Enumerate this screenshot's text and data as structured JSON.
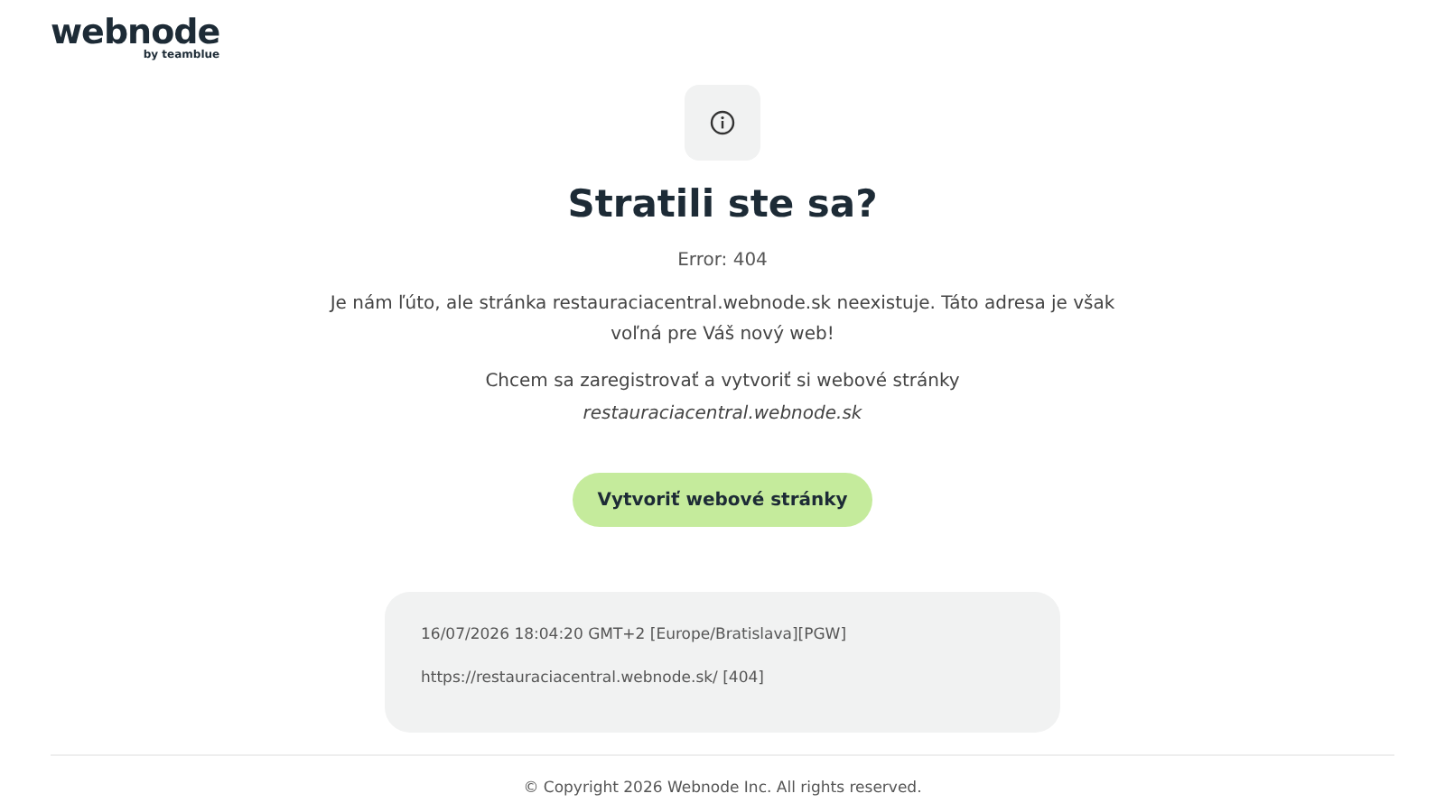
{
  "logo": {
    "name": "webnode",
    "tagline": "by teamblue"
  },
  "heading": "Stratili ste sa?",
  "error": "Error: 404",
  "message": "Je nám ľúto, ale stránka restauraciacentral.webnode.sk neexistuje. Táto adresa je však voľná pre Váš nový web!",
  "register_text": "Chcem sa zaregistrovať a vytvoriť si webové stránky",
  "register_domain": "restauraciacentral.webnode.sk",
  "button": "Vytvoriť webové stránky",
  "details": [
    "16/07/2026 18:04:20 GMT+2 [Europe/Bratislava][PGW]",
    "https://restauraciacentral.webnode.sk/ [404]"
  ],
  "footer": "© Copyright 2026 Webnode Inc. All rights reserved."
}
